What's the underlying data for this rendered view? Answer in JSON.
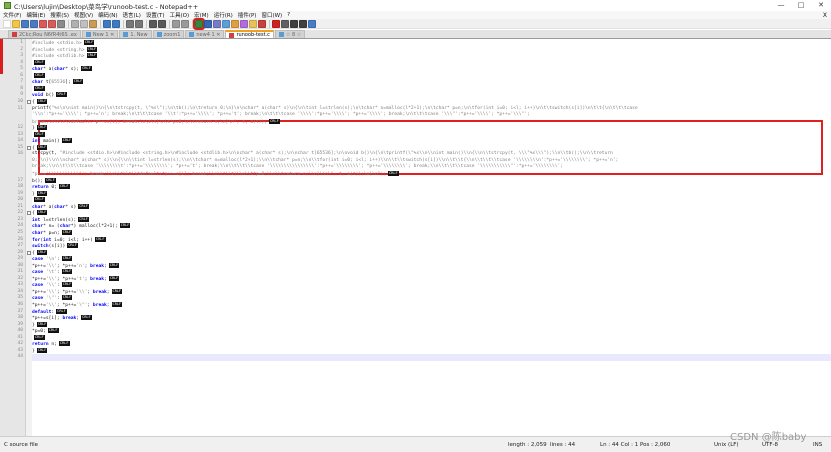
{
  "window": {
    "title": "C:\\Users\\lujin\\Desktop\\菜鸟学\\runoob-test.c - Notepad++",
    "controls": [
      "—",
      "□",
      "✕"
    ]
  },
  "menu": {
    "items": [
      "文件(F)",
      "编辑(E)",
      "搜索(S)",
      "视图(V)",
      "编码(N)",
      "语言(L)",
      "设置(T)",
      "工具(O)",
      "宏(M)",
      "运行(R)",
      "插件(P)",
      "窗口(W)",
      "?"
    ],
    "close_doc": "X"
  },
  "toolbar": {
    "buttons": [
      {
        "name": "new-file-icon",
        "color": "#ffffff"
      },
      {
        "name": "open-file-icon",
        "color": "#f3c64b"
      },
      {
        "name": "save-icon",
        "color": "#4a7cc4"
      },
      {
        "name": "save-all-icon",
        "color": "#4a7cc4"
      },
      {
        "name": "close-icon",
        "color": "#d85a5a"
      },
      {
        "name": "close-all-icon",
        "color": "#d85a5a"
      },
      {
        "name": "print-icon",
        "color": "#8a8a8a"
      },
      {
        "name": "sep"
      },
      {
        "name": "cut-icon",
        "color": "#b0b0b0"
      },
      {
        "name": "copy-icon",
        "color": "#c0c0c0"
      },
      {
        "name": "paste-icon",
        "color": "#c99b54"
      },
      {
        "name": "sep"
      },
      {
        "name": "undo-icon",
        "color": "#3d7ac2"
      },
      {
        "name": "redo-icon",
        "color": "#3d7ac2"
      },
      {
        "name": "sep"
      },
      {
        "name": "find-icon",
        "color": "#777777"
      },
      {
        "name": "replace-icon",
        "color": "#777777"
      },
      {
        "name": "sep"
      },
      {
        "name": "zoom-in-icon",
        "color": "#5a5a5a"
      },
      {
        "name": "zoom-out-icon",
        "color": "#5a5a5a"
      },
      {
        "name": "sep"
      },
      {
        "name": "sync-vertical-icon",
        "color": "#9a9a9a"
      },
      {
        "name": "sync-horizontal-icon",
        "color": "#9a9a9a"
      },
      {
        "name": "sep"
      },
      {
        "name": "word-wrap-icon",
        "color": "#2f8a3d",
        "highlighted": true
      },
      {
        "name": "show-all-characters-icon",
        "color": "#3467b5"
      },
      {
        "name": "indent-guide-icon",
        "color": "#7a7ac8"
      },
      {
        "name": "user-language-icon",
        "color": "#5aa0d8"
      },
      {
        "name": "document-map-icon",
        "color": "#e0a040"
      },
      {
        "name": "function-list-icon",
        "color": "#b36be0"
      },
      {
        "name": "folder-workspace-icon",
        "color": "#e8c252"
      },
      {
        "name": "monitoring-icon",
        "color": "#c84040"
      },
      {
        "name": "sep"
      },
      {
        "name": "record-macro-icon",
        "color": "#d02020"
      },
      {
        "name": "stop-macro-icon",
        "color": "#606060"
      },
      {
        "name": "play-macro-icon",
        "color": "#404040"
      },
      {
        "name": "run-macro-multiple-icon",
        "color": "#404040"
      },
      {
        "name": "save-macro-icon",
        "color": "#4a7cc4"
      }
    ]
  },
  "tabs": [
    {
      "label": "2Ckc;Rou N6fR4t6S .ex",
      "icon_color": "#d04040",
      "active": false
    },
    {
      "label": "New 1 ✕",
      "icon_color": "#5b9bd5",
      "active": false
    },
    {
      "label": "1. New",
      "icon_color": "#5b9bd5",
      "active": false
    },
    {
      "label": "zoom1",
      "icon_color": "#5b9bd5",
      "active": false
    },
    {
      "label": "new4 1 ✕",
      "icon_color": "#5b9bd5",
      "active": false
    },
    {
      "label": "runoob-test.c",
      "icon_color": "#d04040",
      "active": true
    },
    {
      "label": "☆ 8 ☆",
      "icon_color": "#5b9bd5",
      "active": false
    }
  ],
  "editor": {
    "lines": [
      {
        "n": "1",
        "parts": [
          {
            "t": "#include <stdio.h>",
            "c": "str"
          }
        ],
        "eol": true
      },
      {
        "n": "2",
        "parts": [
          {
            "t": "#include <string.h>",
            "c": "str"
          }
        ],
        "eol": true
      },
      {
        "n": "3",
        "parts": [
          {
            "t": "#include <stdlib.h>",
            "c": "str"
          }
        ],
        "eol": true
      },
      {
        "n": "4",
        "parts": [],
        "eol": true
      },
      {
        "n": "5",
        "parts": [
          {
            "t": "char",
            "c": "kw"
          },
          {
            "t": "* a(",
            "c": ""
          },
          {
            "t": "char",
            "c": "kw"
          },
          {
            "t": "* s);",
            "c": ""
          }
        ],
        "eol": true
      },
      {
        "n": "6",
        "parts": [],
        "eol": true
      },
      {
        "n": "7",
        "parts": [
          {
            "t": "char",
            "c": "kw"
          },
          {
            "t": " t[",
            "c": ""
          },
          {
            "t": "65536",
            "c": "str"
          },
          {
            "t": "];",
            "c": ""
          }
        ],
        "eol": true
      },
      {
        "n": "8",
        "parts": [],
        "eol": true
      },
      {
        "n": "9",
        "parts": [
          {
            "t": "void",
            "c": "kw"
          },
          {
            "t": " b()",
            "c": ""
          }
        ],
        "eol": true
      },
      {
        "n": "10",
        "parts": [
          {
            "t": "{",
            "c": ""
          }
        ],
        "eol": true
      },
      {
        "n": "11",
        "parts": [
          {
            "t": "    printf(",
            "c": ""
          },
          {
            "t": "\"%s\\n\\nint main()\\n{\\n\\tstrcpy(t, \\\"%s\\\");\\n\\tb();\\n\\treturn 0;\\n}\\n\\nchar* a(char* s)\\n{\\n\\tint l=strlen(s);\\n\\tchar* n=malloc(l*2+1);\\n\\tchar* p=n;\\n\\tfor(int i=0; i<l; i++)\\n\\t\\tswitch(s[i])\\n\\t\\t{\\n\\t\\t\\tcase",
            "c": "str"
          }
        ],
        "eol": false
      },
      {
        "n": "",
        "parts": [
          {
            "t": "      '\\\\n':*p++='\\\\\\\\'; *p++='n'; break;\\n\\t\\t\\tcase '\\\\t':*p++='\\\\\\\\'; *p++='t'; break;\\n\\t\\t\\tcase '\\\\\\\\':*p++='\\\\\\\\'; *p++='\\\\\\\\'; break;\\n\\t\\t\\tcase '\\\\\\\"':*p++='\\\\\\\\'; *p++='\\\\\\\"';",
            "c": "str"
          }
        ],
        "eol": false
      },
      {
        "n": "",
        "parts": [
          {
            "t": "      break;\\n\\t\\t\\tdefault:*p++=s[i]; break;\\n\\t\\t}\\n\\t*p=0;\\n\\treturn n;\\n}\\n\", t, a(t));",
            "c": "str"
          }
        ],
        "eol": true
      },
      {
        "n": "12",
        "parts": [
          {
            "t": "}",
            "c": ""
          }
        ],
        "eol": true
      },
      {
        "n": "13",
        "parts": [],
        "eol": true
      },
      {
        "n": "14",
        "parts": [
          {
            "t": "int",
            "c": "kw"
          },
          {
            "t": " main()",
            "c": ""
          }
        ],
        "eol": true
      },
      {
        "n": "15",
        "parts": [
          {
            "t": "{",
            "c": ""
          }
        ],
        "eol": true
      },
      {
        "n": "16",
        "parts": [
          {
            "t": "    strcpy(t, ",
            "c": ""
          },
          {
            "t": "\"#include <stdio.h>\\n#include <string.h>\\n#include <stdlib.h>\\n\\nchar* a(char* s);\\n\\nchar t[65536];\\n\\nvoid b()\\n{\\n\\tprintf(\\\"%s\\\\n\\\\nint main()\\\\n{\\\\n\\\\tstrcpy(t, \\\\\\\"%s\\\\\\\");\\\\n\\\\tb();\\\\n\\\\treturn",
            "c": "str"
          }
        ],
        "eol": false
      },
      {
        "n": "",
        "parts": [
          {
            "t": "      0;\\\\n}\\\\n\\\\nchar* a(char* s)\\\\n{\\\\n\\\\tint l=strlen(s);\\\\n\\\\tchar* n=malloc(l*2+1);\\\\n\\\\tchar* p=n;\\\\n\\\\tfor(int i=0; i<l; i++)\\\\n\\\\t\\\\tswitch(s[i])\\\\n\\\\t\\\\t{\\\\n\\\\t\\\\t\\\\tcase '\\\\\\\\\\\\\\\\n':*p++='\\\\\\\\\\\\\\\\'; *p++='n';",
            "c": "str"
          }
        ],
        "eol": false
      },
      {
        "n": "",
        "parts": [
          {
            "t": "      break;\\\\n\\\\t\\\\t\\\\tcase '\\\\\\\\\\\\\\\\t':*p++='\\\\\\\\\\\\\\\\'; *p++='t'; break;\\\\n\\\\t\\\\t\\\\tcase '\\\\\\\\\\\\\\\\\\\\\\\\\\\\\\\\':*p++='\\\\\\\\\\\\\\\\'; *p++='\\\\\\\\\\\\\\\\'; break;\\\\n\\\\t\\\\t\\\\tcase '\\\\\\\\\\\\\\\\\\\\\\\"':*p++='\\\\\\\\\\\\\\\\';",
            "c": "str"
          }
        ],
        "eol": false
      },
      {
        "n": "",
        "parts": [
          {
            "t": "      *p++='\\\\\\\\\\\\\\\\\\\\\\\"'; break;\\\\n\\\\t\\\\t\\\\tdefault:*p++=s[i]; break;\\\\n\\\\t\\\\t}\\\\n\\\\t*p=0;\\\\n\\\\treturn n;\\\\n}\\\\n\\\", t, a(t));\\n}\\n\");",
            "c": "str"
          }
        ],
        "eol": true
      },
      {
        "n": "17",
        "parts": [
          {
            "t": "    b();",
            "c": ""
          }
        ],
        "eol": true
      },
      {
        "n": "18",
        "parts": [
          {
            "t": "    ",
            "c": ""
          },
          {
            "t": "return",
            "c": "kw"
          },
          {
            "t": " 0;",
            "c": ""
          }
        ],
        "eol": true
      },
      {
        "n": "19",
        "parts": [
          {
            "t": "}",
            "c": ""
          }
        ],
        "eol": true
      },
      {
        "n": "20",
        "parts": [],
        "eol": true
      },
      {
        "n": "21",
        "parts": [
          {
            "t": "char",
            "c": "kw"
          },
          {
            "t": "* a(",
            "c": ""
          },
          {
            "t": "char",
            "c": "kw"
          },
          {
            "t": "* s)",
            "c": ""
          }
        ],
        "eol": true
      },
      {
        "n": "22",
        "parts": [
          {
            "t": "{",
            "c": ""
          }
        ],
        "eol": true
      },
      {
        "n": "23",
        "parts": [
          {
            "t": "    ",
            "c": ""
          },
          {
            "t": "int",
            "c": "kw"
          },
          {
            "t": " l=strlen(s);",
            "c": ""
          }
        ],
        "eol": true
      },
      {
        "n": "24",
        "parts": [
          {
            "t": "    ",
            "c": ""
          },
          {
            "t": "char",
            "c": "kw"
          },
          {
            "t": "* n= (",
            "c": ""
          },
          {
            "t": "char",
            "c": "kw"
          },
          {
            "t": "*) malloc(l*2+1);",
            "c": ""
          }
        ],
        "eol": true
      },
      {
        "n": "25",
        "parts": [
          {
            "t": "    ",
            "c": ""
          },
          {
            "t": "char",
            "c": "kw"
          },
          {
            "t": "* p=n;",
            "c": ""
          }
        ],
        "eol": true
      },
      {
        "n": "26",
        "parts": [
          {
            "t": "    ",
            "c": ""
          },
          {
            "t": "for",
            "c": "kw"
          },
          {
            "t": "(",
            "c": ""
          },
          {
            "t": "int",
            "c": "kw"
          },
          {
            "t": " i=0; i<l; i++)",
            "c": ""
          }
        ],
        "eol": true
      },
      {
        "n": "27",
        "parts": [
          {
            "t": "        ",
            "c": ""
          },
          {
            "t": "switch",
            "c": "kw"
          },
          {
            "t": "(s[i])",
            "c": ""
          }
        ],
        "eol": true
      },
      {
        "n": "28",
        "parts": [
          {
            "t": "        {",
            "c": ""
          }
        ],
        "eol": true
      },
      {
        "n": "29",
        "parts": [
          {
            "t": "            ",
            "c": ""
          },
          {
            "t": "case",
            "c": "kw"
          },
          {
            "t": " ",
            "c": ""
          },
          {
            "t": "'\\n'",
            "c": "str"
          },
          {
            "t": ":",
            "c": ""
          }
        ],
        "eol": true
      },
      {
        "n": "30",
        "parts": [
          {
            "t": "                *p++=",
            "c": ""
          },
          {
            "t": "'\\\\'",
            "c": "str"
          },
          {
            "t": "; *p++=",
            "c": ""
          },
          {
            "t": "'n'",
            "c": "str"
          },
          {
            "t": "; ",
            "c": ""
          },
          {
            "t": "break",
            "c": "kw"
          },
          {
            "t": ";",
            "c": ""
          }
        ],
        "eol": true
      },
      {
        "n": "31",
        "parts": [
          {
            "t": "            ",
            "c": ""
          },
          {
            "t": "case",
            "c": "kw"
          },
          {
            "t": " ",
            "c": ""
          },
          {
            "t": "'\\t'",
            "c": "str"
          },
          {
            "t": ":",
            "c": ""
          }
        ],
        "eol": true
      },
      {
        "n": "32",
        "parts": [
          {
            "t": "                *p++=",
            "c": ""
          },
          {
            "t": "'\\\\'",
            "c": "str"
          },
          {
            "t": "; *p++=",
            "c": ""
          },
          {
            "t": "'t'",
            "c": "str"
          },
          {
            "t": "; ",
            "c": ""
          },
          {
            "t": "break",
            "c": "kw"
          },
          {
            "t": ";",
            "c": ""
          }
        ],
        "eol": true
      },
      {
        "n": "33",
        "parts": [
          {
            "t": "            ",
            "c": ""
          },
          {
            "t": "case",
            "c": "kw"
          },
          {
            "t": " ",
            "c": ""
          },
          {
            "t": "'\\\\'",
            "c": "str"
          },
          {
            "t": ":",
            "c": ""
          }
        ],
        "eol": true
      },
      {
        "n": "34",
        "parts": [
          {
            "t": "                *p++=",
            "c": ""
          },
          {
            "t": "'\\\\'",
            "c": "str"
          },
          {
            "t": "; *p++=",
            "c": ""
          },
          {
            "t": "'\\\\'",
            "c": "str"
          },
          {
            "t": "; ",
            "c": ""
          },
          {
            "t": "break",
            "c": "kw"
          },
          {
            "t": ";",
            "c": ""
          }
        ],
        "eol": true
      },
      {
        "n": "35",
        "parts": [
          {
            "t": "            ",
            "c": ""
          },
          {
            "t": "case",
            "c": "kw"
          },
          {
            "t": " ",
            "c": ""
          },
          {
            "t": "'\\\"'",
            "c": "str"
          },
          {
            "t": ":",
            "c": ""
          }
        ],
        "eol": true
      },
      {
        "n": "36",
        "parts": [
          {
            "t": "                *p++=",
            "c": ""
          },
          {
            "t": "'\\\\'",
            "c": "str"
          },
          {
            "t": "; *p++=",
            "c": ""
          },
          {
            "t": "'\\\"'",
            "c": "str"
          },
          {
            "t": "; ",
            "c": ""
          },
          {
            "t": "break",
            "c": "kw"
          },
          {
            "t": ";",
            "c": ""
          }
        ],
        "eol": true
      },
      {
        "n": "37",
        "parts": [
          {
            "t": "            ",
            "c": ""
          },
          {
            "t": "default",
            "c": "kw"
          },
          {
            "t": ":",
            "c": ""
          }
        ],
        "eol": true
      },
      {
        "n": "38",
        "parts": [
          {
            "t": "                *p++=s[i]; ",
            "c": ""
          },
          {
            "t": "break",
            "c": "kw"
          },
          {
            "t": ";",
            "c": ""
          }
        ],
        "eol": true
      },
      {
        "n": "39",
        "parts": [
          {
            "t": "        }",
            "c": ""
          }
        ],
        "eol": true
      },
      {
        "n": "40",
        "parts": [
          {
            "t": "    *p=0;",
            "c": ""
          }
        ],
        "eol": true
      },
      {
        "n": "41",
        "parts": [],
        "eol": true
      },
      {
        "n": "42",
        "parts": [
          {
            "t": "    ",
            "c": ""
          },
          {
            "t": "return",
            "c": "kw"
          },
          {
            "t": " n;",
            "c": ""
          }
        ],
        "eol": true
      },
      {
        "n": "43",
        "parts": [
          {
            "t": "}",
            "c": ""
          }
        ],
        "eol": true
      },
      {
        "n": "44",
        "parts": [],
        "eol": false
      }
    ],
    "eol_label": "CRLF",
    "current_line": "44"
  },
  "status": {
    "file_type": "C source file",
    "length": "length : 2,059",
    "lines": "lines : 44",
    "position": "Ln : 44    Col : 1    Pos : 2,060",
    "eol_format": "Unix (LF)",
    "encoding": "UTF-8",
    "mode": "INS"
  },
  "watermark": "CSDN @陈baby"
}
